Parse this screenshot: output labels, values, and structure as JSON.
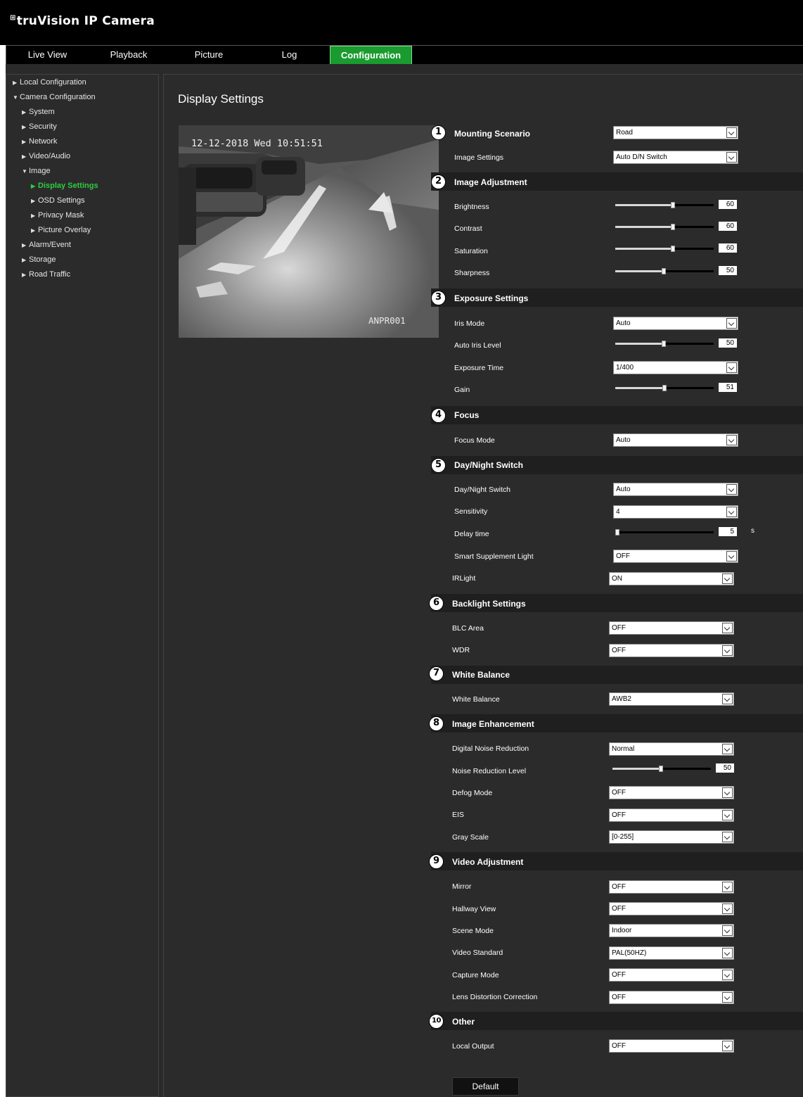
{
  "app": {
    "title": "truVision IP Camera",
    "logo_mark": "⊞"
  },
  "tabs": [
    "Live View",
    "Playback",
    "Picture",
    "Log",
    "Configuration"
  ],
  "active_tab": "Configuration",
  "nav": [
    {
      "label": "Local Configuration",
      "arrow": "▶"
    },
    {
      "label": "Camera Configuration",
      "arrow": "▼"
    },
    {
      "label": "System",
      "arrow": "▶"
    },
    {
      "label": "Security",
      "arrow": "▶"
    },
    {
      "label": "Network",
      "arrow": "▶"
    },
    {
      "label": "Video/Audio",
      "arrow": "▶"
    },
    {
      "label": "Image",
      "arrow": "▼"
    },
    {
      "label": "Display Settings",
      "arrow": "▶"
    },
    {
      "label": "OSD Settings",
      "arrow": "▶"
    },
    {
      "label": "Privacy Mask",
      "arrow": "▶"
    },
    {
      "label": "Picture Overlay",
      "arrow": "▶"
    },
    {
      "label": "Alarm/Event",
      "arrow": "▶"
    },
    {
      "label": "Storage",
      "arrow": "▶"
    },
    {
      "label": "Road Traffic",
      "arrow": "▶"
    }
  ],
  "page_title": "Display Settings",
  "preview": {
    "timestamp": "12-12-2018 Wed 10:51:51",
    "camera_name": "ANPR001"
  },
  "sections": [
    {
      "num": "1",
      "title": "Mounting Scenario"
    },
    {
      "num": "2",
      "title": "Image Adjustment"
    },
    {
      "num": "3",
      "title": "Exposure Settings"
    },
    {
      "num": "4",
      "title": "Focus"
    },
    {
      "num": "5",
      "title": "Day/Night Switch"
    },
    {
      "num": "6",
      "title": "Backlight Settings"
    },
    {
      "num": "7",
      "title": "White Balance"
    },
    {
      "num": "8",
      "title": "Image Enhancement"
    },
    {
      "num": "9",
      "title": "Video Adjustment"
    },
    {
      "num": "10",
      "title": "Other"
    }
  ],
  "rows": [
    {
      "label": "Mounting Scenario",
      "type": "select",
      "value": "Road"
    },
    {
      "label": "Image Settings",
      "type": "select",
      "value": "Auto D/N Switch"
    },
    {
      "label": "Brightness",
      "type": "slider",
      "value": "60"
    },
    {
      "label": "Contrast",
      "type": "slider",
      "value": "60"
    },
    {
      "label": "Saturation",
      "type": "slider",
      "value": "60"
    },
    {
      "label": "Sharpness",
      "type": "slider",
      "value": "50"
    },
    {
      "label": "Iris Mode",
      "type": "select",
      "value": "Auto"
    },
    {
      "label": "Auto Iris Level",
      "type": "slider",
      "value": "50"
    },
    {
      "label": "Exposure Time",
      "type": "select",
      "value": "1/400"
    },
    {
      "label": "Gain",
      "type": "slider",
      "value": "51"
    },
    {
      "label": "Focus Mode",
      "type": "select",
      "value": "Auto"
    },
    {
      "label": "Day/Night Switch",
      "type": "select",
      "value": "Auto"
    },
    {
      "label": "Sensitivity",
      "type": "select",
      "value": "4"
    },
    {
      "label": "Delay time",
      "type": "slider",
      "value": "5",
      "unit": "s"
    },
    {
      "label": "Smart Supplement Light",
      "type": "select",
      "value": "OFF"
    },
    {
      "label": "IRLight",
      "type": "select",
      "value": "ON"
    },
    {
      "label": "BLC Area",
      "type": "select",
      "value": "OFF"
    },
    {
      "label": "WDR",
      "type": "select",
      "value": "OFF"
    },
    {
      "label": "White Balance",
      "type": "select",
      "value": "AWB2"
    },
    {
      "label": "Digital Noise Reduction",
      "type": "select",
      "value": "Normal"
    },
    {
      "label": "Noise Reduction Level",
      "type": "slider",
      "value": "50"
    },
    {
      "label": "Defog Mode",
      "type": "select",
      "value": "OFF"
    },
    {
      "label": "EIS",
      "type": "select",
      "value": "OFF"
    },
    {
      "label": "Gray Scale",
      "type": "select",
      "value": "[0-255]"
    },
    {
      "label": "Mirror",
      "type": "select",
      "value": "OFF"
    },
    {
      "label": "Hallway View",
      "type": "select",
      "value": "OFF"
    },
    {
      "label": "Scene Mode",
      "type": "select",
      "value": "Indoor"
    },
    {
      "label": "Video Standard",
      "type": "select",
      "value": "PAL(50HZ)"
    },
    {
      "label": "Capture Mode",
      "type": "select",
      "value": "OFF"
    },
    {
      "label": "Lens Distortion Correction",
      "type": "select",
      "value": "OFF"
    },
    {
      "label": "Local Output",
      "type": "select",
      "value": "OFF"
    }
  ],
  "slider_levels": {
    "Brightness": 0.6,
    "Contrast": 0.6,
    "Saturation": 0.6,
    "Sharpness": 0.5,
    "Auto Iris Level": 0.5,
    "Gain": 0.51,
    "Delay time": 0.0,
    "Noise Reduction Level": 0.5
  },
  "buttons": {
    "default": "Default"
  },
  "colors": {
    "accent": "#1a9b2f",
    "active_nav": "#2ecc40",
    "background": "#2b2b2b",
    "section_band": "#1f1f1f"
  },
  "icons": {
    "expand": "triangle-right-icon",
    "collapse": "triangle-down-icon",
    "dropdown": "chevron-down-icon"
  }
}
